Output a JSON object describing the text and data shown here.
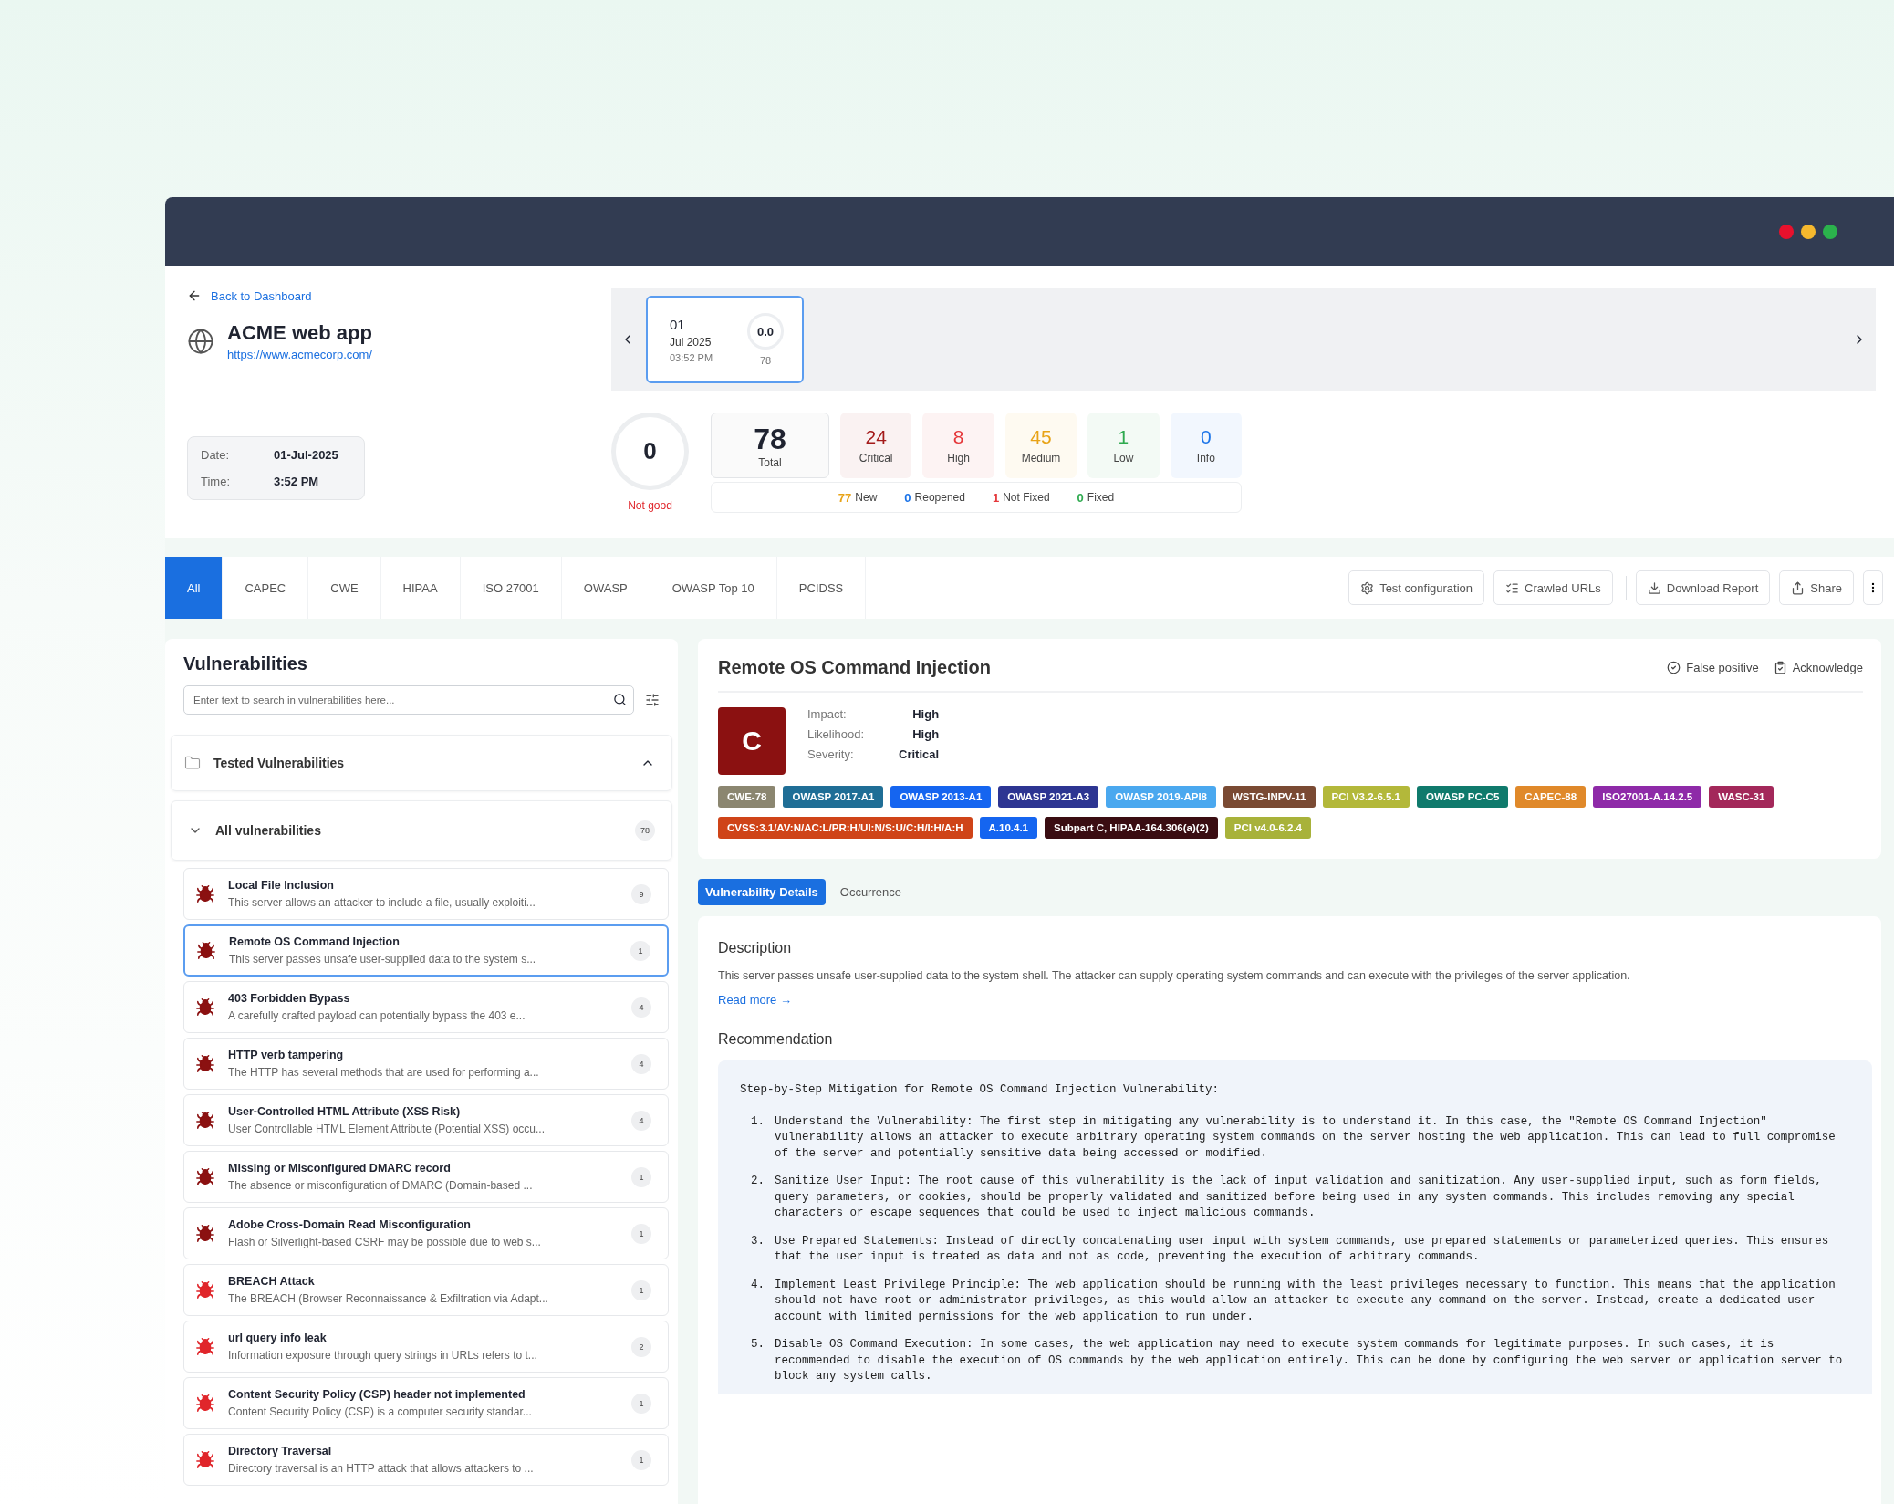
{
  "window": {
    "controls": [
      {
        "color": "#e8112d"
      },
      {
        "color": "#f5b82e"
      },
      {
        "color": "#2bb24c"
      }
    ]
  },
  "header": {
    "back_link": "Back to Dashboard",
    "app_name": "ACME web app",
    "url": "https://www.acmecorp.com/",
    "date_label": "Date:",
    "date": "01-Jul-2025",
    "time_label": "Time:",
    "time": "3:52 PM"
  },
  "scans": [
    {
      "day": "01",
      "month": "Jul 2025",
      "time": "03:52 PM",
      "score": "0.0",
      "count": "78",
      "selected": true
    }
  ],
  "score": {
    "value": "0",
    "caption": "Not good"
  },
  "totals": {
    "value": "78",
    "label": "Total"
  },
  "severities": [
    {
      "value": "24",
      "label": "Critical",
      "color": "#a31a1a"
    },
    {
      "value": "8",
      "label": "High",
      "color": "#e5383b"
    },
    {
      "value": "45",
      "label": "Medium",
      "color": "#e8a317"
    },
    {
      "value": "1",
      "label": "Low",
      "color": "#2eaa4f"
    },
    {
      "value": "0",
      "label": "Info",
      "color": "#1a73e8"
    }
  ],
  "statuses": [
    {
      "count": "77",
      "label": "New",
      "color": "#e8a317"
    },
    {
      "count": "0",
      "label": "Reopened",
      "color": "#1a73e8"
    },
    {
      "count": "1",
      "label": "Not Fixed",
      "color": "#e5383b"
    },
    {
      "count": "0",
      "label": "Fixed",
      "color": "#2eaa4f"
    }
  ],
  "tabs": [
    {
      "label": "All",
      "selected": true
    },
    {
      "label": "CAPEC",
      "selected": false
    },
    {
      "label": "CWE",
      "selected": false
    },
    {
      "label": "HIPAA",
      "selected": false
    },
    {
      "label": "ISO 27001",
      "selected": false
    },
    {
      "label": "OWASP",
      "selected": false
    },
    {
      "label": "OWASP Top 10",
      "selected": false
    },
    {
      "label": "PCIDSS",
      "selected": false
    }
  ],
  "actions": [
    {
      "label": "Test configuration",
      "kind": "config"
    },
    {
      "label": "Crawled URLs",
      "kind": "crawl"
    },
    {
      "label": "Download Report",
      "kind": "download"
    },
    {
      "label": "Share",
      "kind": "share"
    }
  ],
  "vulnerabilities": {
    "title": "Vulnerabilities",
    "search_placeholder": "Enter text to search in vulnerabilities here...",
    "group": {
      "label": "Tested Vulnerabilities",
      "expanded": true
    },
    "category": {
      "label": "All vulnerabilities",
      "count": "78",
      "expanded": true
    },
    "items": [
      {
        "title": "Local File Inclusion",
        "summary": "This server allows an attacker to include a file, usually exploiti...",
        "count": "9",
        "color": "#8b1111",
        "selected": false
      },
      {
        "title": "Remote OS Command Injection",
        "summary": "This server passes unsafe user-supplied data to the system s...",
        "count": "1",
        "color": "#8b1111",
        "selected": true
      },
      {
        "title": "403 Forbidden Bypass",
        "summary": "A carefully crafted payload can potentially bypass the 403 e...",
        "count": "4",
        "color": "#8b1111",
        "selected": false
      },
      {
        "title": "HTTP verb tampering",
        "summary": "The HTTP has several methods that are used for performing a...",
        "count": "4",
        "color": "#8b1111",
        "selected": false
      },
      {
        "title": "User-Controlled HTML Attribute (XSS Risk)",
        "summary": "User Controllable HTML Element Attribute (Potential XSS) occu...",
        "count": "4",
        "color": "#8b1111",
        "selected": false
      },
      {
        "title": "Missing or Misconfigured DMARC record",
        "summary": "The absence or misconfiguration of DMARC (Domain-based ...",
        "count": "1",
        "color": "#8b1111",
        "selected": false
      },
      {
        "title": "Adobe Cross-Domain Read Misconfiguration",
        "summary": "Flash or Silverlight-based CSRF may be possible due to web s...",
        "count": "1",
        "color": "#8b1111",
        "selected": false
      },
      {
        "title": "BREACH Attack",
        "summary": "The BREACH (Browser Reconnaissance & Exfiltration via Adapt...",
        "count": "1",
        "color": "#e0262b",
        "selected": false
      },
      {
        "title": "url query info leak",
        "summary": "Information exposure through query strings in URLs refers to t...",
        "count": "2",
        "color": "#e0262b",
        "selected": false
      },
      {
        "title": "Content Security Policy (CSP) header not implemented",
        "summary": "Content Security Policy (CSP) is a computer security standar...",
        "count": "1",
        "color": "#e0262b",
        "selected": false
      },
      {
        "title": "Directory Traversal",
        "summary": "Directory traversal is an HTTP attack that allows attackers to ...",
        "count": "1",
        "color": "#e0262b",
        "selected": false
      }
    ]
  },
  "detail": {
    "title": "Remote OS Command Injection",
    "actions": [
      {
        "label": "False positive",
        "kind": "false_positive"
      },
      {
        "label": "Acknowledge",
        "kind": "acknowledge"
      }
    ],
    "grade": "C",
    "facts": [
      {
        "label": "Impact:",
        "value": "High"
      },
      {
        "label": "Likelihood:",
        "value": "High"
      },
      {
        "label": "Severity:",
        "value": "Critical"
      }
    ],
    "tags": [
      {
        "label": "CWE-78",
        "color": "#8b8670"
      },
      {
        "label": "OWASP 2017-A1",
        "color": "#1f6e96"
      },
      {
        "label": "OWASP 2013-A1",
        "color": "#1565f0"
      },
      {
        "label": "OWASP 2021-A3",
        "color": "#2d3592"
      },
      {
        "label": "OWASP 2019-API8",
        "color": "#4aa8ef"
      },
      {
        "label": "WSTG-INPV-11",
        "color": "#7a4a33"
      },
      {
        "label": "PCI V3.2-6.5.1",
        "color": "#b3b83a"
      },
      {
        "label": "OWASP PC-C5",
        "color": "#0f7a6c"
      },
      {
        "label": "CAPEC-88",
        "color": "#e0892a"
      },
      {
        "label": "ISO27001-A.14.2.5",
        "color": "#8e2aa8"
      },
      {
        "label": "WASC-31",
        "color": "#a3285a"
      },
      {
        "label": "CVSS:3.1/AV:N/AC:L/PR:H/UI:N/S:U/C:H/I:H/A:H",
        "color": "#cf4418"
      },
      {
        "label": "A.10.4.1",
        "color": "#1565f0"
      },
      {
        "label": "Subpart C, HIPAA-164.306(a)(2)",
        "color": "#3a0d12"
      },
      {
        "label": "PCI v4.0-6.2.4",
        "color": "#a8b23a"
      }
    ],
    "tabs": [
      {
        "label": "Vulnerability Details",
        "selected": true
      },
      {
        "label": "Occurrence",
        "selected": false
      }
    ],
    "description_heading": "Description",
    "description": "This server passes unsafe user-supplied data to the system shell. The attacker can supply operating system commands and can execute with the privileges of the server application.",
    "read_more": "Read more →",
    "recommendation_heading": "Recommendation",
    "recommendation": {
      "intro": "Step-by-Step Mitigation for Remote OS Command Injection Vulnerability:",
      "steps": [
        {
          "number": "1.",
          "text": "Understand the Vulnerability: The first step in mitigating any vulnerability is to understand it. In this case, the \"Remote OS Command Injection\" vulnerability allows an attacker to execute arbitrary operating system commands on the server hosting the web application. This can lead to full compromise of the server and potentially sensitive data being accessed or modified."
        },
        {
          "number": "2.",
          "text": "Sanitize User Input: The root cause of this vulnerability is the lack of input validation and sanitization. Any user-supplied input, such as form fields, query parameters, or cookies, should be properly validated and sanitized before being used in any system commands. This includes removing any special characters or escape sequences that could be used to inject malicious commands."
        },
        {
          "number": "3.",
          "text": "Use Prepared Statements: Instead of directly concatenating user input with system commands, use prepared statements or parameterized queries. This ensures that the user input is treated as data and not as code, preventing the execution of arbitrary commands."
        },
        {
          "number": "4.",
          "text": "Implement Least Privilege Principle: The web application should be running with the least privileges necessary to function. This means that the application should not have root or administrator privileges, as this would allow an attacker to execute any command on the server. Instead, create a dedicated user account with limited permissions for the web application to run under."
        },
        {
          "number": "5.",
          "text": "Disable OS Command Execution: In some cases, the web application may need to execute system commands for legitimate purposes. In such cases, it is recommended to disable the execution of OS commands by the web application entirely. This can be done by configuring the web server or application server to block any system calls."
        }
      ]
    }
  }
}
